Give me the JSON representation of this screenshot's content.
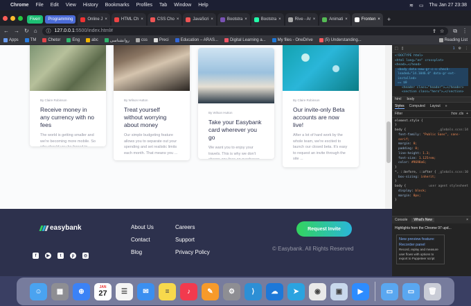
{
  "menubar": {
    "app": "Chrome",
    "items": [
      "File",
      "Edit",
      "View",
      "History",
      "Bookmarks",
      "Profiles",
      "Tab",
      "Window",
      "Help"
    ],
    "clock": "Thu Jan 27 23:38"
  },
  "tabs": [
    {
      "label": "Fiverr",
      "color": "#1dbf73",
      "pill": true
    },
    {
      "label": "Programming",
      "color": "#4b6bd6",
      "pill": true
    },
    {
      "label": "Online J",
      "color": "#e33"
    },
    {
      "label": "HTML Ch",
      "color": "#e44"
    },
    {
      "label": "CSS Cho",
      "color": "#e55"
    },
    {
      "label": "JavaScri",
      "color": "#e55"
    },
    {
      "label": "Bootstra",
      "color": "#7952b3"
    },
    {
      "label": "Bootstra",
      "color": "#2fa"
    },
    {
      "label": "Rive - Ar",
      "color": "#aaa"
    },
    {
      "label": "Animati",
      "color": "#5b5"
    },
    {
      "label": "Fronten",
      "color": "#fff",
      "active": true
    }
  ],
  "address": {
    "host": "127.0.0.1",
    "rest": ":5500/index.html#"
  },
  "bookmarks": [
    "Apps",
    "TM",
    "Chetor",
    "Eng",
    "abc",
    "روانشناسی",
    "css",
    "Preci",
    "Education – ARAS...",
    "Digital Learning a...",
    "My files - OneDrive",
    "(5) Understanding...",
    "Reading List"
  ],
  "cards": [
    {
      "by": "By Claire Robinson",
      "title": "Receive money in any currency with no fees",
      "desc": "The world is getting smaller and we're becoming more mobile. So why should you be forced to only receive money in a single ..."
    },
    {
      "by": "By Wilson Hutton",
      "title": "Treat yourself without worrying about money",
      "desc": "Our simple budgeting feature allows you to separate out your spending and set realistic limits each month. That means you ..."
    },
    {
      "by": "By Wilson Hutton",
      "title": "Take your Easybank card wherever you go",
      "desc": "We want you to enjoy your travels. This is why we don't charge any fees on purchases while you're abroad. We'll even show you ..."
    },
    {
      "by": "By Claire Robinson",
      "title": "Our invite-only Beta accounts are now live!",
      "desc": "After a lot of hard work by the whole team, we're excited to launch our closed beta. It's easy to request an invite through the site ..."
    }
  ],
  "footer": {
    "brand": "easybank",
    "links_col1": [
      "About Us",
      "Contact",
      "Blog"
    ],
    "links_col2": [
      "Careers",
      "Support",
      "Privacy Policy"
    ],
    "cta": "Request Invite",
    "copyright": "© Easybank. All Rights Reserved",
    "socials": [
      "facebook-icon",
      "youtube-icon",
      "twitter-icon",
      "pinterest-icon",
      "instagram-icon"
    ]
  },
  "devtools": {
    "dom": [
      "<!DOCTYPE html>",
      "<html lang=\"en\" crossplat>",
      "<head>…</head>",
      "<body data-new-gr-c-s-check-loaded=\"14.1046.0\" data-gr-ext-installed>",
      "== $0",
      "<header class=\"header\">…</header>",
      "<section class=\"hero\">…</section>"
    ],
    "crumbs": [
      "html",
      "body"
    ],
    "panel_tabs": [
      "Styles",
      "Computed",
      "Layout",
      "»"
    ],
    "filter": "Filter",
    "filter_flags": ":hov .cls",
    "styles": [
      {
        "sel": "element.style {",
        "props": []
      },
      {
        "sel": "body {",
        "file": "_globals.scss:14",
        "props": [
          [
            "font-family",
            "\"Public Sans\", sans-serif;"
          ],
          [
            "margin",
            "0;"
          ],
          [
            "padding",
            "0;"
          ],
          [
            "line-height",
            "1.3;"
          ],
          [
            "font-size",
            "1.125rem;"
          ],
          [
            "color",
            "#9698a6;"
          ]
        ]
      },
      {
        "sel": "*, ::before, ::after {",
        "file": "_globals.scss:10",
        "props": [
          [
            "box-sizing",
            "inherit;"
          ]
        ]
      },
      {
        "sel": "body {",
        "file": "user agent stylesheet",
        "props": [
          [
            "display",
            "block;"
          ],
          [
            "margin",
            "8px;"
          ]
        ]
      }
    ],
    "drawer_tabs": [
      "Console",
      "What's New"
    ],
    "drawer_head": "Highlights from the Chrome 97 upd...",
    "drawer_title": "New preview feature: Recorder panel",
    "drawer_desc": "Record, replay and measure user flows with options to export to Puppeteer script"
  },
  "dock": [
    {
      "name": "finder-icon",
      "color": "#4aa3f0"
    },
    {
      "name": "launchpad-icon",
      "color": "#8e8e93"
    },
    {
      "name": "safari-icon",
      "color": "#3b82f6"
    },
    {
      "name": "calendar-icon",
      "color": "#ffffff"
    },
    {
      "name": "reminders-icon",
      "color": "#f5f5f5"
    },
    {
      "name": "mail-icon",
      "color": "#3b8ff0"
    },
    {
      "name": "notes-icon",
      "color": "#f7d94c"
    },
    {
      "name": "music-icon",
      "color": "#f23a4e"
    },
    {
      "name": "pages-icon",
      "color": "#f79a2a"
    },
    {
      "name": "system-preferences-icon",
      "color": "#8e8e93"
    },
    {
      "name": "vscode-icon",
      "color": "#2d8fd5"
    },
    {
      "name": "onedrive-icon",
      "color": "#1e78d8"
    },
    {
      "name": "telegram-icon",
      "color": "#2ba3e0"
    },
    {
      "name": "chrome-icon",
      "color": "#e9e9e9"
    },
    {
      "name": "preview-icon",
      "color": "#c8d8ec"
    },
    {
      "name": "zoom-icon",
      "color": "#2d8cff"
    },
    {
      "name": "downloads-folder-icon",
      "color": "#5aa7f0"
    },
    {
      "name": "documents-folder-icon",
      "color": "#5aa7f0"
    },
    {
      "name": "trash-icon",
      "color": "#c9ccd6"
    }
  ],
  "calendar": {
    "month": "JAN",
    "day": "27"
  }
}
